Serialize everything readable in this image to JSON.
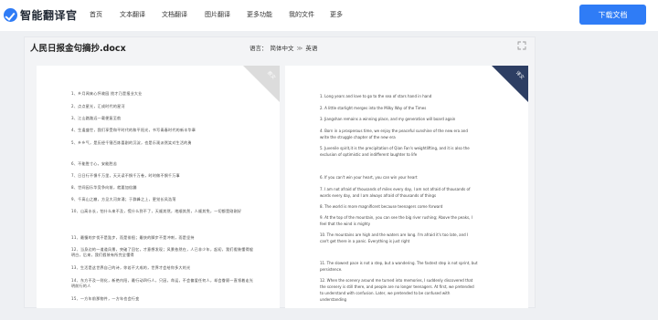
{
  "app": {
    "name": "智能翻译官"
  },
  "nav": [
    "首页",
    "文本翻译",
    "文档翻译",
    "图片翻译",
    "更多功能",
    "我的文件",
    "更多"
  ],
  "download_button": "下载文档",
  "document": {
    "title": "人民日报金句摘抄.docx"
  },
  "language": {
    "label": "语言：",
    "source": "简体中文",
    "arrow": "≫",
    "target": "英语"
  },
  "badges": {
    "source": "原文",
    "target": "译文"
  },
  "original_lines": [
    "1、乡月闻来心怀故园 揽才乃是报业大业",
    "2、点点星光，汇成时代的星河",
    "3、江山路路远一载便复至航",
    "4、生逢盛世，我们享受和平时代的和平阳光，书写青春时代的新丰华章",
    "5、乡乡气，是历经千锤百炼喜剧的沉淀，也是乐观派然笑对生活的勇",
    "6、不能胜寸心，安能胜苦",
    "7、日日行不惧千万里，天天读不惧千万卷，时时做不惧千万事",
    "8、世间因乐华竞争向前，就要加倍蹦",
    "9、千高山之巅，方见大河奔涌；于群峰之上，更觉长风浩荡",
    "10、山高水长，怕什么来不及，慌什么到不了，天顺其然，地顺其然，人顺其免，一切都是刚刚好",
    "11、最慢的步伐不是跬步，而是徘徊；最快的脚步不是冲刺，而是坚持",
    "12、当身边的一道道风景，突破了回忆，才意想发现；风景依然在，人已非少年，起初，我们假装懂得般明白，后来，我们假装有所完全懂得",
    "13、生活是这世界自己的诗，你若不大成的，世界才会给你多大的光",
    "14、东方不及一则化，新绝内阳，最行动四行人，只因，命运，不会偏爱任何人，却会眷顾一直领着走光明前行的人",
    "15、一方年前那物件，一方年也会行变"
  ],
  "translated_lines": [
    "1. Long years and love to go to the sea of stars hand in hand",
    "2. A little starlight merges into the Milky Way of the Times",
    "3. Jiangshan remains a winning place, and my generation will board again",
    "4. Born in a prosperous time, we enjoy the peaceful sunshine of the new era and",
    "write the struggle chapter of the new era",
    "5. Juvenile spirit,it is the precipitation of Qian Fan's weightlifting, and it is also the",
    "exclusion of optimistic and indifferent laughter to life",
    "6. If you can't win your heart, you can win your heart",
    "7. I am not afraid of thousands of miles every day, I am not afraid of thousands of",
    "words every day, and I am always afraid of thousands of things",
    "8. The world is more magnificent because teenagers come forward",
    "9. At the top of the mountain, you can see the big river rushing; Above the peaks, I",
    "feel that the wind is mighty",
    "10. The mountains are high and the waters are long. I'm afraid it's too late, and I",
    "can't get there in a panic. Everything is just right",
    "11. The slowest pace is not a step, but a wandering. The fastest step is not sprint, but",
    "persistence.",
    "12. When the scenery around me turned into memories, I suddenly discovered that",
    "the scenery is still there, and people are no longer teenagers. At first, we pretended",
    "to understand with confusion. Later, we pretended to be confused with",
    "understanding"
  ]
}
